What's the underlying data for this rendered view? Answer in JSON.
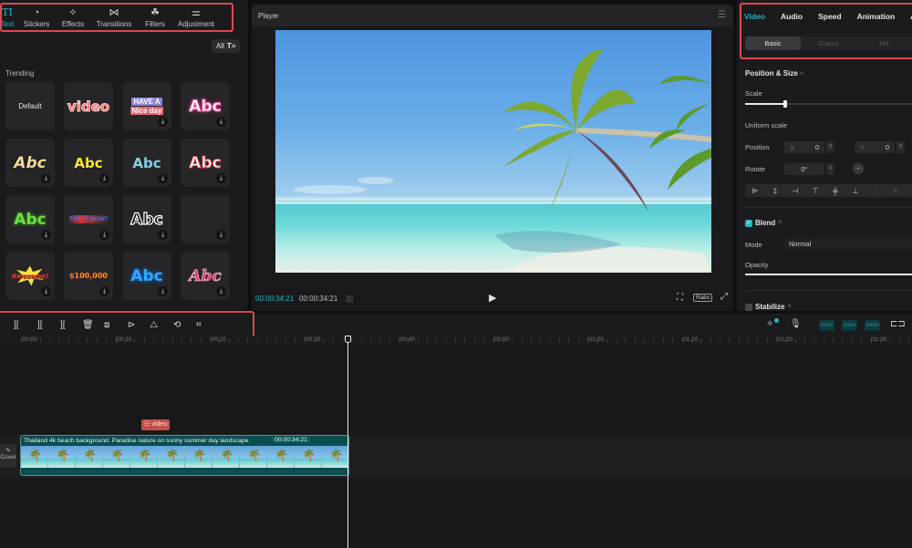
{
  "left_panel": {
    "tabs": [
      {
        "label": "Text",
        "icon": "TI",
        "active": true
      },
      {
        "label": "Stickers",
        "icon": "◔"
      },
      {
        "label": "Effects",
        "icon": "✧"
      },
      {
        "label": "Transitions",
        "icon": "⋈"
      },
      {
        "label": "Filters",
        "icon": "☘"
      },
      {
        "label": "Adjustment",
        "icon": "⚌"
      }
    ],
    "filter_button": "All",
    "section_title": "Trending",
    "templates": [
      {
        "text": "Default"
      },
      {
        "text": "video"
      },
      {
        "text": "HAVE A Nice day"
      },
      {
        "text": "Abc"
      },
      {
        "text": "Abc"
      },
      {
        "text": "Abc"
      },
      {
        "text": "Abc"
      },
      {
        "text": "Abc"
      },
      {
        "text": "Abc"
      },
      {
        "text": "TRY IT NOW!"
      },
      {
        "text": "Abc"
      },
      {
        "text": ""
      },
      {
        "text": "Awesome!"
      },
      {
        "text": "$100,000"
      },
      {
        "text": "Abc"
      },
      {
        "text": "Abc"
      }
    ],
    "download_icon": "⤓"
  },
  "player": {
    "title": "Player",
    "current_time": "00:00:34:21",
    "total_time": "00:00:34:21",
    "ratio_label": "Ratio"
  },
  "right_panel": {
    "tabs": [
      "Video",
      "Audio",
      "Speed",
      "Animation",
      "Ad"
    ],
    "active_tab": "Video",
    "subtabs": [
      "Basic",
      "Cutout",
      "Ma"
    ],
    "active_subtab": "Basic",
    "position_size": {
      "title": "Position & Size",
      "scale_label": "Scale",
      "scale_value_fraction": 0.24,
      "uniform_scale_label": "Uniform scale",
      "position_label": "Position",
      "x_label": "X",
      "x_value": "0",
      "y_label": "Y",
      "y_value": "0",
      "rotate_label": "Rotate",
      "rotate_value": "0°"
    },
    "blend": {
      "title": "Blend",
      "enabled": true,
      "mode_label": "Mode",
      "mode_value": "Normal",
      "opacity_label": "Opacity",
      "opacity_fraction": 1.0
    },
    "stabilize": {
      "title": "Stabilize",
      "enabled": false
    }
  },
  "timeline": {
    "ruler_labels": [
      "00:00",
      "00:10",
      "00:20",
      "00:30",
      "00:40",
      "00:50",
      "01:00",
      "01:10",
      "01:20",
      "01:30"
    ],
    "clip": {
      "title": "Thailand 4k beach background. Paradise nature on sunny summer day landscape.",
      "duration": "00:00:34:21"
    },
    "track_tag": "video",
    "cover_label": "Cover"
  },
  "colors": {
    "accent": "#23b5c3",
    "highlight_border": "#e0484f",
    "clip_bg": "#0c4d4f"
  }
}
